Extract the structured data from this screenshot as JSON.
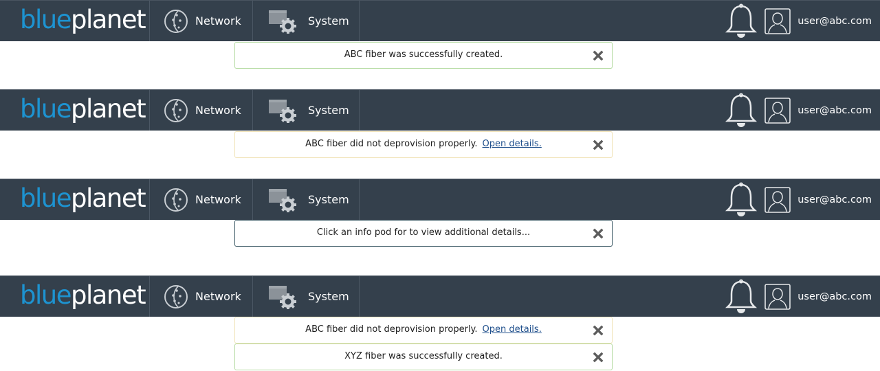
{
  "navbar": {
    "logo_blue": "blue",
    "logo_planet": "planet",
    "network_label": "Network",
    "system_label": "System",
    "user_label": "user@abc.com"
  },
  "toasts": {
    "success": {
      "message": "ABC fiber was successfully created."
    },
    "warning": {
      "message": "ABC fiber did not deprovision properly.",
      "link": "Open details."
    },
    "info": {
      "message": "Click an info pod for to view additional details..."
    },
    "stack": [
      {
        "message": "ABC fiber did not deprovision properly.",
        "link": "Open details."
      },
      {
        "message": "XYZ fiber was successfully created."
      }
    ]
  },
  "colors": {
    "navbar_bg": "#34404c",
    "brand_blue": "#1d93d1",
    "success_border": "#b4dba1",
    "warning_border": "#f1e3b8",
    "info_border": "#3d5a66",
    "link": "#1f4f8c"
  },
  "icons": [
    "network-globe-icon",
    "system-gear-icon",
    "bell-icon",
    "user-avatar-icon",
    "close-icon"
  ]
}
